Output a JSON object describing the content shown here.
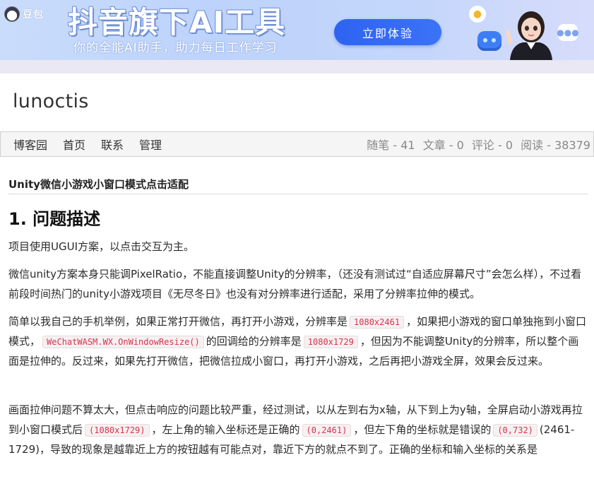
{
  "banner": {
    "brand_name": "豆包",
    "headline": "抖音旗下AI工具",
    "subline": "你的全能AI助手，助力每日工作学习",
    "cta": "立即体验"
  },
  "blog": {
    "title": "lunoctis"
  },
  "nav": {
    "items": [
      "博客园",
      "首页",
      "联系",
      "管理"
    ],
    "stats": {
      "posts": "随笔 - 41",
      "articles": "文章 - 0",
      "comments": "评论 - 0",
      "reads": "阅读 - 38379"
    }
  },
  "post": {
    "title": "Unity微信小游戏小窗口模式点击适配",
    "heading": "1. 问题描述",
    "p1": "项目使用UGUI方案，以点击交互为主。",
    "p2": "微信unity方案本身只能调PixelRatio，不能直接调整Unity的分辨率，（还没有测试过“自适应屏幕尺寸”会怎么样），不过看前段时间热门的unity小游戏项目《无尽冬日》也没有对分辨率进行适配，采用了分辨率拉伸的模式。",
    "p3": {
      "t1": "简单以我自己的手机举例，如果正常打开微信，再打开小游戏，分辨率是",
      "c1": "1080x2461",
      "t2": "，如果把小游戏的窗口单独拖到小窗口模式，",
      "c2": "WeChatWASM.WX.OnWindowResize()",
      "t3": "的回调给的分辨率是",
      "c3": "1080x1729",
      "t4": "，但因为不能调整Unity的分辨率，所以整个画面是拉伸的。反过来，如果先打开微信，把微信拉成小窗口，再打开小游戏，之后再把小游戏全屏，效果会反过来。"
    },
    "p4": {
      "t1": "画面拉伸问题不算太大，但点击响应的问题比较严重，经过测试，以从左到右为x轴，从下到上为y轴，全屏启动小游戏再拉到小窗口模式后",
      "c1": "(1080x1729)",
      "t2": "，左上角的输入坐标还是正确的",
      "c2": "(0,2461)",
      "t3": "，但左下角的坐标就是错误的",
      "c3": "(0,732)",
      "t4": "(2461-1729)，导致的现象是越靠近上方的按钮越有可能点对，靠近下方的就点不到了。正确的坐标和输入坐标的关系是"
    }
  }
}
